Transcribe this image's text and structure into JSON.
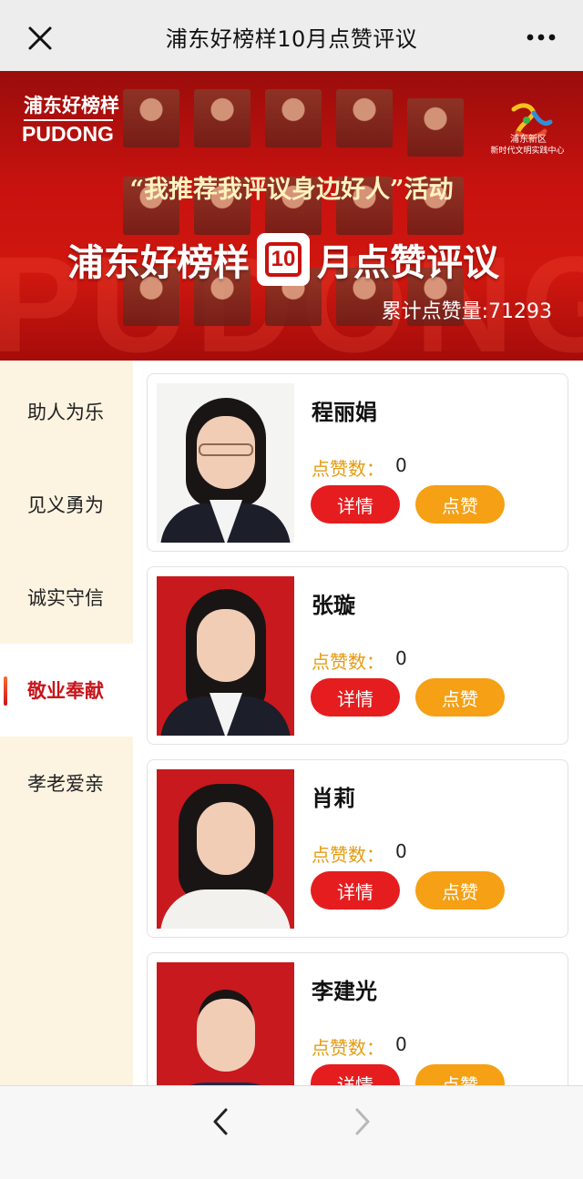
{
  "topbar": {
    "title": "浦东好榜样10月点赞评议",
    "close_icon": "close-icon",
    "more_icon": "more-dots-icon"
  },
  "banner": {
    "logo_cn": "浦东好榜样",
    "logo_en": "PUDONG",
    "center_name_line1": "浦东新区",
    "center_name_line2": "新时代文明实践中心",
    "subtitle": "“我推荐我评议身边好人”活动",
    "headline_left": "浦东好榜样",
    "headline_month": "10",
    "headline_right": "月点赞评议",
    "total_likes": "累计点赞量:71293",
    "background_text": "PUDONG"
  },
  "sidebar": {
    "items": [
      {
        "label": "助人为乐",
        "active": false
      },
      {
        "label": "见义勇为",
        "active": false
      },
      {
        "label": "诚实守信",
        "active": false
      },
      {
        "label": "敬业奉献",
        "active": true
      },
      {
        "label": "孝老爱亲",
        "active": false
      }
    ]
  },
  "cards": [
    {
      "name": "程丽娟",
      "likes_label": "点赞数：",
      "likes": "0",
      "detail_label": "详情",
      "like_label": "点赞",
      "photo_bg": "white"
    },
    {
      "name": "张璇",
      "likes_label": "点赞数：",
      "likes": "0",
      "detail_label": "详情",
      "like_label": "点赞",
      "photo_bg": "red"
    },
    {
      "name": "肖莉",
      "likes_label": "点赞数：",
      "likes": "0",
      "detail_label": "详情",
      "like_label": "点赞",
      "photo_bg": "red"
    },
    {
      "name": "李建光",
      "likes_label": "点赞数：",
      "likes": "0",
      "detail_label": "详情",
      "like_label": "点赞",
      "photo_bg": "red"
    }
  ],
  "colors": {
    "accent_red": "#e51d1f",
    "accent_orange": "#f5a015",
    "likes_label": "#e59b12",
    "sidebar_bg": "#fdf3e1",
    "active_text": "#c8151b"
  },
  "bottombar": {
    "back_icon": "chevron-left-icon",
    "forward_icon": "chevron-right-icon"
  }
}
